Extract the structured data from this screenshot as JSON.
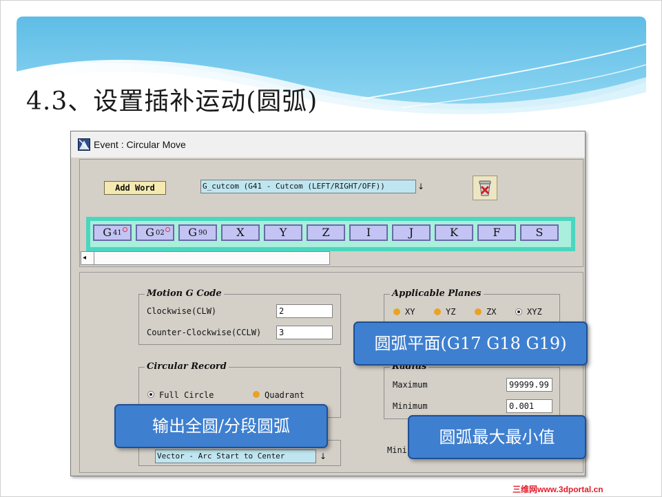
{
  "slide": {
    "title": "4.3、设置插补运动(圆弧)"
  },
  "dialog": {
    "title": "Event : Circular Move",
    "add_word_label": "Add Word",
    "word_combo_value": "G_cutcom (G41 - Cutcom (LEFT/RIGHT/OFF))",
    "combo_arrow": "↓",
    "word_buttons": [
      {
        "letter": "G",
        "sub": "41",
        "selected": true
      },
      {
        "letter": "G",
        "sub": "02",
        "selected": true
      },
      {
        "letter": "G",
        "sub": "90",
        "selected": false
      },
      {
        "letter": "X",
        "sub": "",
        "selected": false
      },
      {
        "letter": "Y",
        "sub": "",
        "selected": false
      },
      {
        "letter": "Z",
        "sub": "",
        "selected": false
      },
      {
        "letter": "I",
        "sub": "",
        "selected": false
      },
      {
        "letter": "J",
        "sub": "",
        "selected": false
      },
      {
        "letter": "K",
        "sub": "",
        "selected": false
      },
      {
        "letter": "F",
        "sub": "",
        "selected": false
      },
      {
        "letter": "S",
        "sub": "",
        "selected": false
      }
    ],
    "hscroll_left_arrow": "◂",
    "motion_g_code": {
      "title": "Motion G Code",
      "clockwise_label": "Clockwise(CLW)",
      "clockwise_value": "2",
      "counter_clockwise_label": "Counter-Clockwise(CCLW)",
      "counter_clockwise_value": "3"
    },
    "applicable_planes": {
      "title": "Applicable Planes",
      "options": [
        "XY",
        "YZ",
        "ZX",
        "XYZ"
      ],
      "selected": "XYZ"
    },
    "circular_record": {
      "title": "Circular Record",
      "options": [
        "Full Circle",
        "Quadrant"
      ],
      "selected": "Full Circle"
    },
    "radius": {
      "title": "Radius",
      "maximum_label": "Maximum",
      "maximum_value": "99999.99",
      "minimum_label": "Minimum",
      "minimum_value": "0.001"
    },
    "ijk_definition": {
      "value": "Vector - Arc Start to Center"
    },
    "min_arc_label_partial": "Mini"
  },
  "callouts": {
    "planes": "圆弧平面(G17 G18 G19)",
    "record": "输出全圆/分段圆弧",
    "radius": "圆弧最大最小值"
  },
  "watermark": "三维网www.3dportal.cn",
  "colors": {
    "word_bar": "#4bd6c0",
    "word_button": "#c3c4f4",
    "combo_field": "#bfe6f0",
    "callout": "#3e7fd0",
    "radio_unselected": "#e8a326",
    "dialog_face": "#d4d0c8",
    "add_word_button": "#f4e9b0"
  }
}
